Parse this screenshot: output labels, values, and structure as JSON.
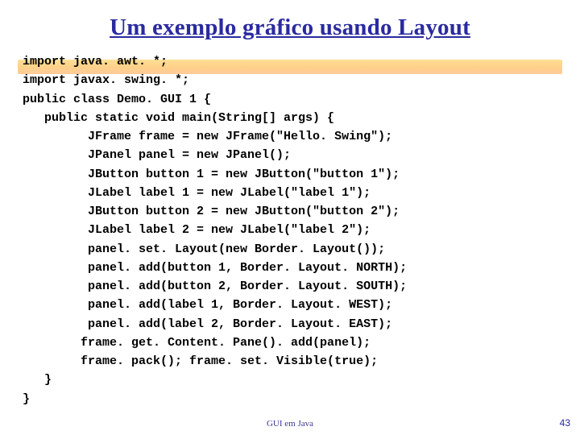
{
  "title": "Um exemplo gráfico usando Layout",
  "code_lines": [
    "import java. awt. *;",
    "import javax. swing. *;",
    "public class Demo. GUI 1 {",
    "   public static void main(String[] args) {",
    "         JFrame frame = new JFrame(\"Hello. Swing\");",
    "         JPanel panel = new JPanel();",
    "         JButton button 1 = new JButton(\"button 1\");",
    "         JLabel label 1 = new JLabel(\"label 1\");",
    "         JButton button 2 = new JButton(\"button 2\");",
    "         JLabel label 2 = new JLabel(\"label 2\");",
    "         panel. set. Layout(new Border. Layout());",
    "         panel. add(button 1, Border. Layout. NORTH);",
    "         panel. add(button 2, Border. Layout. SOUTH);",
    "         panel. add(label 1, Border. Layout. WEST);",
    "         panel. add(label 2, Border. Layout. EAST);",
    "        frame. get. Content. Pane(). add(panel);",
    "        frame. pack(); frame. set. Visible(true);",
    "   }",
    "}"
  ],
  "footer": "GUI em Java",
  "page_number": "43"
}
